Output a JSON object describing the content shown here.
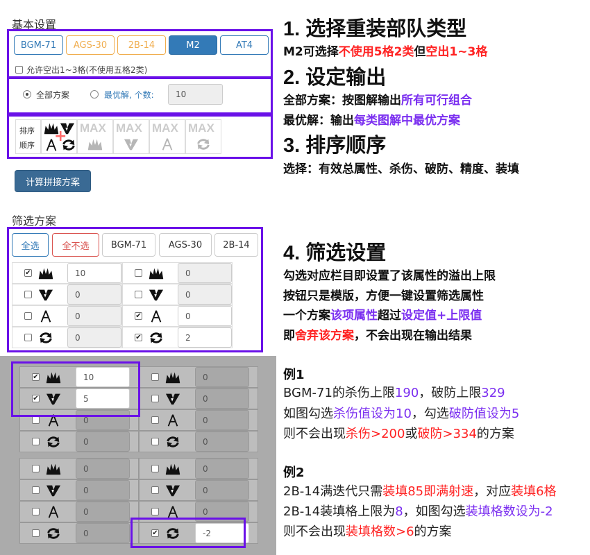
{
  "basic": {
    "heading": "基本设置",
    "types": [
      "BGM-71",
      "AGS-30",
      "2B-14",
      "M2",
      "AT4"
    ],
    "allow_label": "允许空出1~3格(不使用五格2类)",
    "radio_all": "全部方案",
    "radio_best": "最优解, 个数:",
    "best_count": "10",
    "sort_label_1": "排序",
    "sort_label_2": "顺序",
    "max_label": "MAX",
    "compute_button": "计算拼接方案"
  },
  "filter": {
    "heading": "筛选方案",
    "buttons": [
      "全选",
      "全不选",
      "BGM-71",
      "AGS-30",
      "2B-14"
    ],
    "rows": [
      {
        "left_checked": true,
        "left_value": "10",
        "right_checked": false,
        "right_value": "0"
      },
      {
        "left_checked": false,
        "left_value": "0",
        "right_checked": false,
        "right_value": "0"
      },
      {
        "left_checked": false,
        "left_value": "0",
        "right_checked": true,
        "right_value": "0"
      },
      {
        "left_checked": false,
        "left_value": "0",
        "right_checked": true,
        "right_value": "2"
      }
    ]
  },
  "example_grid_1": {
    "rows": [
      {
        "left_checked": true,
        "left_value": "10",
        "right_checked": false,
        "right_value": "0"
      },
      {
        "left_checked": true,
        "left_value": "5",
        "right_checked": false,
        "right_value": "0"
      },
      {
        "left_checked": false,
        "left_value": "0",
        "right_checked": false,
        "right_value": "0"
      },
      {
        "left_checked": false,
        "left_value": "0",
        "right_checked": false,
        "right_value": "0"
      }
    ]
  },
  "example_grid_2": {
    "rows": [
      {
        "left_checked": false,
        "left_value": "0",
        "right_checked": false,
        "right_value": "0"
      },
      {
        "left_checked": false,
        "left_value": "0",
        "right_checked": false,
        "right_value": "0"
      },
      {
        "left_checked": false,
        "left_value": "0",
        "right_checked": false,
        "right_value": "0"
      },
      {
        "left_checked": false,
        "left_value": "0",
        "right_checked": true,
        "right_value": "-2"
      }
    ]
  },
  "guide": {
    "s1_title": "1. 选择重装部队类型",
    "s1_line_a": "M2可选择",
    "s1_line_b": "不使用5格2类",
    "s1_line_c": "但",
    "s1_line_d": "空出1~3格",
    "s2_title": "2. 设定输出",
    "s2_l1_a": "全部方案：按图解输出",
    "s2_l1_b": "所有可行组合",
    "s2_l2_a": "最优解：输出",
    "s2_l2_b": "每类图解中最优方案",
    "s3_title": "3. 排序顺序",
    "s3_line": "选择：有效总属性、杀伤、破防、精度、装填",
    "s4_title": "4. 筛选设置",
    "s4_l1": "勾选对应栏目即设置了该属性的溢出上限",
    "s4_l2": "按钮只是模版，方便一键设置筛选属性",
    "s4_l3_a": "一个方案",
    "s4_l3_b": "该项属性",
    "s4_l3_c": "超过",
    "s4_l3_d": "设定值+上限值",
    "s4_l4_a": "即",
    "s4_l4_b": "舍弃该方案",
    "s4_l4_c": "，不会出现在输出结果",
    "ex1_title": "例1",
    "ex1_l1_a": "BGM-71的杀伤上限",
    "ex1_l1_b": "190",
    "ex1_l1_c": "，破防上限",
    "ex1_l1_d": "329",
    "ex1_l2_a": "如图勾选",
    "ex1_l2_b": "杀伤值设为10",
    "ex1_l2_c": "，勾选",
    "ex1_l2_d": "破防值设为5",
    "ex1_l3_a": "则不会出现",
    "ex1_l3_b": "杀伤>200",
    "ex1_l3_c": "或",
    "ex1_l3_d": "破防>334",
    "ex1_l3_e": "的方案",
    "ex2_title": "例2",
    "ex2_l1_a": "2B-14满迭代只需",
    "ex2_l1_b": "装填85即满射速",
    "ex2_l1_c": "，对应",
    "ex2_l1_d": "装填6格",
    "ex2_l2_a": "2B-14装填格上限为",
    "ex2_l2_b": "8",
    "ex2_l2_c": "，如图勾选",
    "ex2_l2_d": "装填格数设为-2",
    "ex2_l3_a": "则不会出现",
    "ex2_l3_b": "装填格数>6",
    "ex2_l3_c": "的方案"
  },
  "colors": {
    "accent_purple": "#6a11e8",
    "primary_blue": "#337ab7",
    "warning_orange": "#f0ad4e",
    "danger_red": "#d9534f",
    "highlight_red": "#ff2222",
    "highlight_purple": "#7b2ff0"
  }
}
